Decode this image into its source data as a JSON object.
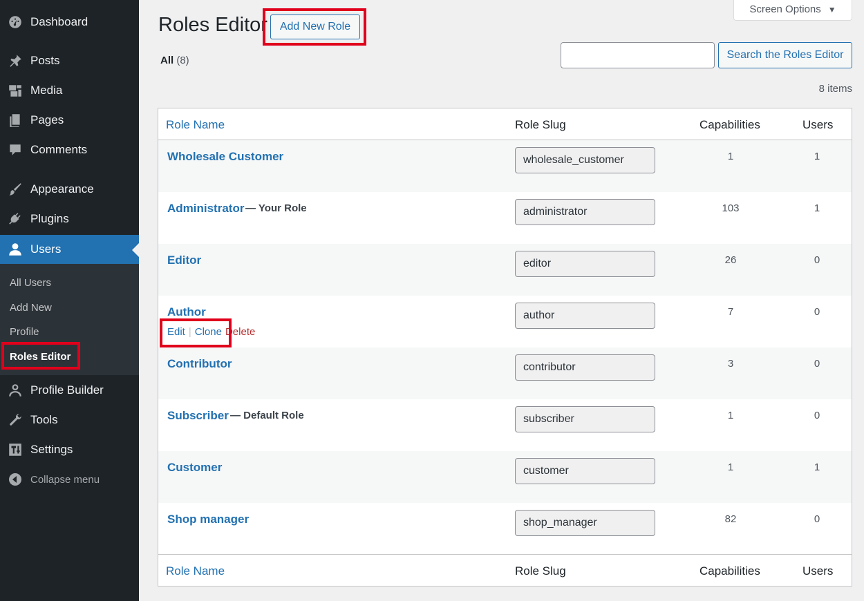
{
  "sidebar": {
    "items": [
      {
        "label": "Dashboard",
        "icon": "dashboard-icon"
      },
      {
        "label": "Posts",
        "icon": "pin-icon"
      },
      {
        "label": "Media",
        "icon": "media-icon"
      },
      {
        "label": "Pages",
        "icon": "pages-icon"
      },
      {
        "label": "Comments",
        "icon": "comment-icon"
      },
      {
        "label": "Appearance",
        "icon": "paintbrush-icon"
      },
      {
        "label": "Plugins",
        "icon": "plug-icon"
      },
      {
        "label": "Users",
        "icon": "user-icon"
      },
      {
        "label": "Profile Builder",
        "icon": "person-outline-icon"
      },
      {
        "label": "Tools",
        "icon": "wrench-icon"
      },
      {
        "label": "Settings",
        "icon": "settings-sliders-icon"
      }
    ],
    "submenu": [
      "All Users",
      "Add New",
      "Profile",
      "Roles Editor"
    ],
    "collapse_label": "Collapse menu"
  },
  "header": {
    "title": "Roles Editor",
    "add_new_label": "Add New Role",
    "screen_options_label": "Screen Options",
    "filter_all_label": "All",
    "filter_all_count": "(8)",
    "search_button_label": "Search the Roles Editor",
    "search_value": "",
    "items_count": "8 items"
  },
  "table": {
    "columns": [
      "Role Name",
      "Role Slug",
      "Capabilities",
      "Users"
    ],
    "rows": [
      {
        "name": "Wholesale Customer",
        "note": "",
        "slug": "wholesale_customer",
        "capabilities": "1",
        "users": "1"
      },
      {
        "name": "Administrator",
        "note": "— Your Role",
        "slug": "administrator",
        "capabilities": "103",
        "users": "1"
      },
      {
        "name": "Editor",
        "note": "",
        "slug": "editor",
        "capabilities": "26",
        "users": "0"
      },
      {
        "name": "Author",
        "note": "",
        "slug": "author",
        "capabilities": "7",
        "users": "0"
      },
      {
        "name": "Contributor",
        "note": "",
        "slug": "contributor",
        "capabilities": "3",
        "users": "0"
      },
      {
        "name": "Subscriber",
        "note": "— Default Role",
        "slug": "subscriber",
        "capabilities": "1",
        "users": "0"
      },
      {
        "name": "Customer",
        "note": "",
        "slug": "customer",
        "capabilities": "1",
        "users": "1"
      },
      {
        "name": "Shop manager",
        "note": "",
        "slug": "shop_manager",
        "capabilities": "82",
        "users": "0"
      }
    ],
    "row_actions": {
      "edit": "Edit",
      "separator": "|",
      "clone": "Clone",
      "delete": "Delete"
    }
  },
  "colors": {
    "sidebar_bg": "#1d2327",
    "accent": "#2271b1",
    "highlight": "#e0001b",
    "delete": "#b32d2e"
  }
}
